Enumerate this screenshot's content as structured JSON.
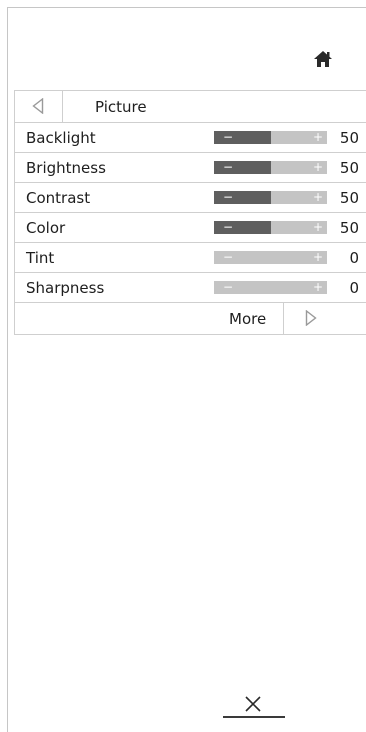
{
  "header": {
    "home_icon": "home-icon",
    "back_icon": "triangle-left-icon",
    "title": "Picture"
  },
  "colors": {
    "slider_track": "#c4c4c4",
    "slider_fill": "#5f5f5f",
    "divider": "#cfcfcf",
    "text": "#1e1e1e"
  },
  "settings": [
    {
      "label": "Backlight",
      "value": "50",
      "level": 0.5,
      "minus": "−",
      "plus": "+"
    },
    {
      "label": "Brightness",
      "value": "50",
      "level": 0.5,
      "minus": "−",
      "plus": "+"
    },
    {
      "label": "Contrast",
      "value": "50",
      "level": 0.5,
      "minus": "−",
      "plus": "+"
    },
    {
      "label": "Color",
      "value": "50",
      "level": 0.5,
      "minus": "−",
      "plus": "+"
    },
    {
      "label": "Tint",
      "value": "0",
      "level": 0.0,
      "minus": "−",
      "plus": "+"
    },
    {
      "label": "Sharpness",
      "value": "0",
      "level": 0.0,
      "minus": "−",
      "plus": "+"
    }
  ],
  "footer_nav": {
    "more_label": "More",
    "next_icon": "triangle-right-icon"
  },
  "close": {
    "icon": "close-icon"
  }
}
